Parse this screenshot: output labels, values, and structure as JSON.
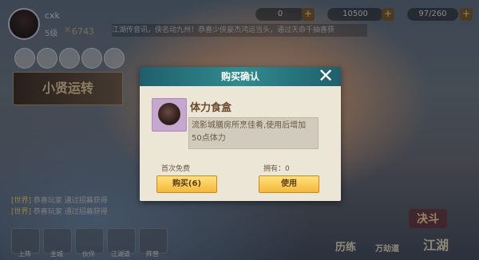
{
  "player": {
    "name": "cxk",
    "level": "5级",
    "power": "6743"
  },
  "resources": [
    {
      "value": "0"
    },
    {
      "value": "10500"
    },
    {
      "value": "97/260"
    }
  ],
  "marquee": "江湖传音讯，侠名动九州！恭喜少侠豪杰鸿运当头，通过天命千抽喜获",
  "banner": {
    "text": "小贤运转"
  },
  "chat": [
    {
      "tag": "[世界]",
      "pre": "恭喜玩家",
      "name": "",
      "post": "通过招募获得"
    },
    {
      "tag": "[世界]",
      "pre": "恭喜玩家",
      "name": "",
      "post": "通过招募获得"
    }
  ],
  "bottom_menu": [
    "上阵",
    "主城",
    "伙伴",
    "江湖道",
    "阵营"
  ],
  "bottom_right": {
    "duel": "决斗",
    "practice": "历练",
    "jianghu": "江湖",
    "wanjie": "万劫道"
  },
  "modal": {
    "title": "购买确认",
    "close_glyph": "✕",
    "item": {
      "name": "体力食盒",
      "description": "流影城膳房所烹佳肴,使用后增加50点体力",
      "icon": "food-box-icon"
    },
    "first_free": "首次免费",
    "owned": "拥有：0",
    "buy_label": "购买(6)",
    "use_label": "使用"
  },
  "colors": {
    "header": "#2f8c8e",
    "panel": "#ece6d6",
    "button": "#f2b93a",
    "item_bg": "#c6a7ce"
  }
}
